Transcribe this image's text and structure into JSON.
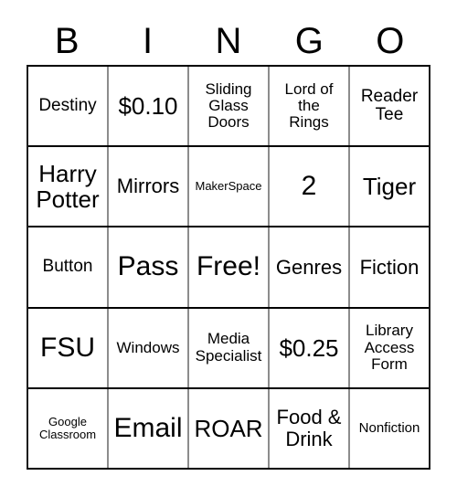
{
  "card": {
    "header_letters": [
      "B",
      "I",
      "N",
      "G",
      "O"
    ],
    "columns": 5,
    "rows": 5,
    "cells": [
      [
        {
          "text": "Destiny",
          "size": "lg"
        },
        {
          "text": "$0.10",
          "size": "2xl"
        },
        {
          "text": "Sliding\nGlass\nDoors",
          "size": "md"
        },
        {
          "text": "Lord of\nthe\nRings",
          "size": "md"
        },
        {
          "text": "Reader\nTee",
          "size": "lg"
        }
      ],
      [
        {
          "text": "Harry\nPotter",
          "size": "2xl"
        },
        {
          "text": "Mirrors",
          "size": "xl"
        },
        {
          "text": "MakerSpace",
          "size": "xs"
        },
        {
          "text": "2",
          "size": "3xl"
        },
        {
          "text": "Tiger",
          "size": "2xl"
        }
      ],
      [
        {
          "text": "Button",
          "size": "lg"
        },
        {
          "text": "Pass",
          "size": "3xl"
        },
        {
          "text": "Free!",
          "size": "3xl"
        },
        {
          "text": "Genres",
          "size": "xl"
        },
        {
          "text": "Fiction",
          "size": "xl"
        }
      ],
      [
        {
          "text": "FSU",
          "size": "3xl"
        },
        {
          "text": "Windows",
          "size": "md"
        },
        {
          "text": "Media\nSpecialist",
          "size": "md"
        },
        {
          "text": "$0.25",
          "size": "2xl"
        },
        {
          "text": "Library\nAccess\nForm",
          "size": "md"
        }
      ],
      [
        {
          "text": "Google\nClassroom",
          "size": "xs"
        },
        {
          "text": "Email",
          "size": "3xl"
        },
        {
          "text": "ROAR",
          "size": "2xl"
        },
        {
          "text": "Food &\nDrink",
          "size": "xl"
        },
        {
          "text": "Nonfiction",
          "size": "sm"
        }
      ]
    ]
  },
  "colors": {
    "background": "#ffffff",
    "text": "#000000",
    "row_rule": "#000000",
    "column_rule": "#8c8c8c"
  }
}
